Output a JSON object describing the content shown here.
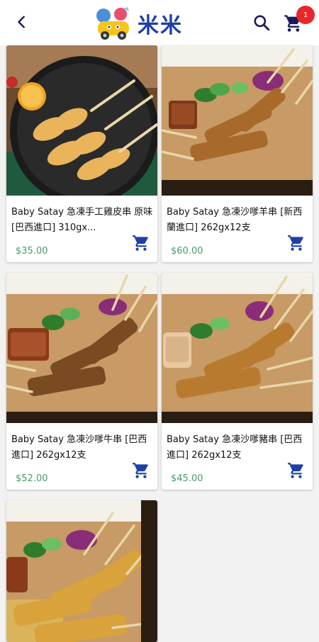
{
  "header": {
    "brand_name": "米米",
    "cart_count": "1",
    "back_icon": "chevron-left-icon",
    "search_icon": "search-icon",
    "cart_icon": "shopping-cart-icon",
    "brand_color": "#1e3fa8",
    "badge_color": "#e8262b"
  },
  "products": [
    {
      "name": "Baby Satay 急凍手工雞皮串 原味 [巴西進口] 310gx...",
      "price": "$35.00"
    },
    {
      "name": "Baby Satay 急凍沙嗲羊串 [新西蘭進口] 262gx12支",
      "price": "$60.00"
    },
    {
      "name": "Baby Satay 急凍沙嗲牛串 [巴西進口] 262gx12支",
      "price": "$52.00"
    },
    {
      "name": "Baby Satay 急凍沙嗲豬串 [巴西進口] 262gx12支",
      "price": "$45.00"
    },
    {
      "name": "",
      "price": ""
    }
  ],
  "colors": {
    "price": "#4a9b6a",
    "cart_icon": "#1e3fa8"
  }
}
